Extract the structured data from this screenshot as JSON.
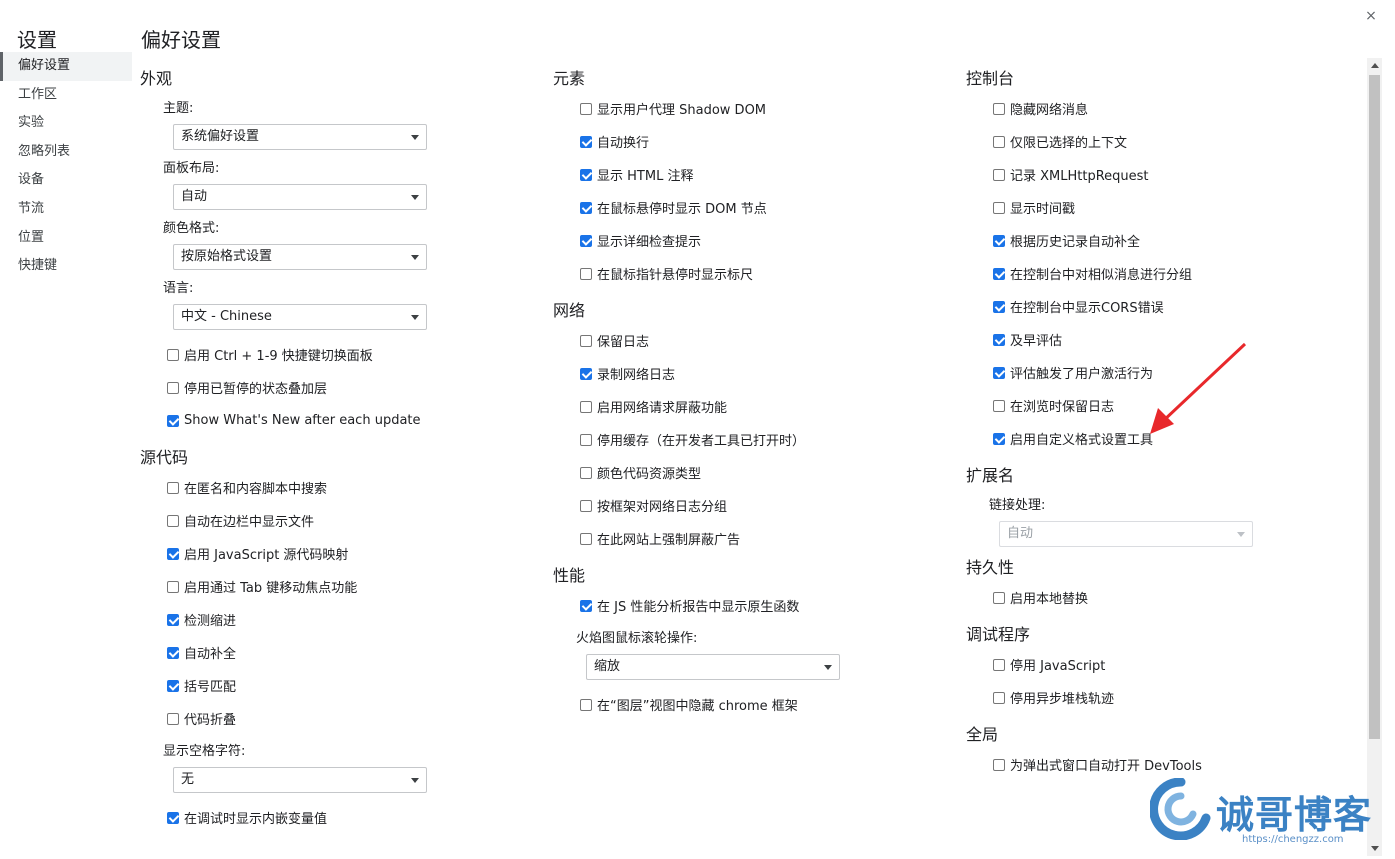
{
  "sidebar": {
    "title": "设置",
    "items": [
      {
        "label": "偏好设置",
        "active": true
      },
      {
        "label": "工作区",
        "active": false
      },
      {
        "label": "实验",
        "active": false
      },
      {
        "label": "忽略列表",
        "active": false
      },
      {
        "label": "设备",
        "active": false
      },
      {
        "label": "节流",
        "active": false
      },
      {
        "label": "位置",
        "active": false
      },
      {
        "label": "快捷键",
        "active": false
      }
    ]
  },
  "page_title": "偏好设置",
  "close_label": "×",
  "columns": [
    [
      {
        "type": "section",
        "label": "外观"
      },
      {
        "type": "label",
        "label": "主题:"
      },
      {
        "type": "select",
        "value": "系统偏好设置"
      },
      {
        "type": "label",
        "label": "面板布局:"
      },
      {
        "type": "select",
        "value": "自动"
      },
      {
        "type": "label",
        "label": "颜色格式:"
      },
      {
        "type": "select",
        "value": "按原始格式设置"
      },
      {
        "type": "label",
        "label": "语言:"
      },
      {
        "type": "select",
        "value": "中文 - Chinese"
      },
      {
        "type": "checkbox",
        "label": "启用 Ctrl + 1-9 快捷键切换面板",
        "checked": false
      },
      {
        "type": "checkbox",
        "label": "停用已暂停的状态叠加层",
        "checked": false
      },
      {
        "type": "checkbox",
        "label": "Show What's New after each update",
        "checked": true
      },
      {
        "type": "section",
        "label": "源代码"
      },
      {
        "type": "checkbox",
        "label": "在匿名和内容脚本中搜索",
        "checked": false
      },
      {
        "type": "checkbox",
        "label": "自动在边栏中显示文件",
        "checked": false
      },
      {
        "type": "checkbox",
        "label": "启用 JavaScript 源代码映射",
        "checked": true
      },
      {
        "type": "checkbox",
        "label": "启用通过 Tab 键移动焦点功能",
        "checked": false
      },
      {
        "type": "checkbox",
        "label": "检测缩进",
        "checked": true
      },
      {
        "type": "checkbox",
        "label": "自动补全",
        "checked": true
      },
      {
        "type": "checkbox",
        "label": "括号匹配",
        "checked": true
      },
      {
        "type": "checkbox",
        "label": "代码折叠",
        "checked": false
      },
      {
        "type": "label",
        "label": "显示空格字符:"
      },
      {
        "type": "select",
        "value": "无"
      },
      {
        "type": "checkbox",
        "label": "在调试时显示内嵌变量值",
        "checked": true
      }
    ],
    [
      {
        "type": "section",
        "label": "元素"
      },
      {
        "type": "checkbox",
        "label": "显示用户代理 Shadow DOM",
        "checked": false
      },
      {
        "type": "checkbox",
        "label": "自动换行",
        "checked": true
      },
      {
        "type": "checkbox",
        "label": "显示 HTML 注释",
        "checked": true
      },
      {
        "type": "checkbox",
        "label": "在鼠标悬停时显示 DOM 节点",
        "checked": true
      },
      {
        "type": "checkbox",
        "label": "显示详细检查提示",
        "checked": true
      },
      {
        "type": "checkbox",
        "label": "在鼠标指针悬停时显示标尺",
        "checked": false
      },
      {
        "type": "section",
        "label": "网络"
      },
      {
        "type": "checkbox",
        "label": "保留日志",
        "checked": false
      },
      {
        "type": "checkbox",
        "label": "录制网络日志",
        "checked": true
      },
      {
        "type": "checkbox",
        "label": "启用网络请求屏蔽功能",
        "checked": false
      },
      {
        "type": "checkbox",
        "label": "停用缓存（在开发者工具已打开时）",
        "checked": false
      },
      {
        "type": "checkbox",
        "label": "颜色代码资源类型",
        "checked": false
      },
      {
        "type": "checkbox",
        "label": "按框架对网络日志分组",
        "checked": false
      },
      {
        "type": "checkbox",
        "label": "在此网站上强制屏蔽广告",
        "checked": false
      },
      {
        "type": "section",
        "label": "性能"
      },
      {
        "type": "checkbox",
        "label": "在 JS 性能分析报告中显示原生函数",
        "checked": true
      },
      {
        "type": "label",
        "label": "火焰图鼠标滚轮操作:"
      },
      {
        "type": "select",
        "value": "缩放"
      },
      {
        "type": "checkbox",
        "label": "在“图层”视图中隐藏 chrome 框架",
        "checked": false
      }
    ],
    [
      {
        "type": "section",
        "label": "控制台"
      },
      {
        "type": "checkbox",
        "label": "隐藏网络消息",
        "checked": false
      },
      {
        "type": "checkbox",
        "label": "仅限已选择的上下文",
        "checked": false
      },
      {
        "type": "checkbox",
        "label": "记录 XMLHttpRequest",
        "checked": false
      },
      {
        "type": "checkbox",
        "label": "显示时间戳",
        "checked": false
      },
      {
        "type": "checkbox",
        "label": "根据历史记录自动补全",
        "checked": true
      },
      {
        "type": "checkbox",
        "label": "在控制台中对相似消息进行分组",
        "checked": true
      },
      {
        "type": "checkbox",
        "label": "在控制台中显示CORS错误",
        "checked": true
      },
      {
        "type": "checkbox",
        "label": "及早评估",
        "checked": true
      },
      {
        "type": "checkbox",
        "label": "评估触发了用户激活行为",
        "checked": true
      },
      {
        "type": "checkbox",
        "label": "在浏览时保留日志",
        "checked": false
      },
      {
        "type": "checkbox",
        "label": "启用自定义格式设置工具",
        "checked": true
      },
      {
        "type": "section",
        "label": "扩展名"
      },
      {
        "type": "label",
        "label": "链接处理:"
      },
      {
        "type": "select",
        "value": "自动",
        "disabled": true
      },
      {
        "type": "section",
        "label": "持久性"
      },
      {
        "type": "checkbox",
        "label": "启用本地替换",
        "checked": false
      },
      {
        "type": "section",
        "label": "调试程序"
      },
      {
        "type": "checkbox",
        "label": "停用 JavaScript",
        "checked": false
      },
      {
        "type": "checkbox",
        "label": "停用异步堆栈轨迹",
        "checked": false
      },
      {
        "type": "section",
        "label": "全局"
      },
      {
        "type": "checkbox",
        "label": "为弹出式窗口自动打开 DevTools",
        "checked": false
      }
    ]
  ],
  "watermark": {
    "text": "诚哥博客",
    "url": "https://chengzz.com"
  },
  "colors": {
    "checkbox_checked": "#1a73e8",
    "annotation_arrow": "#e8282b",
    "watermark": "#3b82c4"
  }
}
